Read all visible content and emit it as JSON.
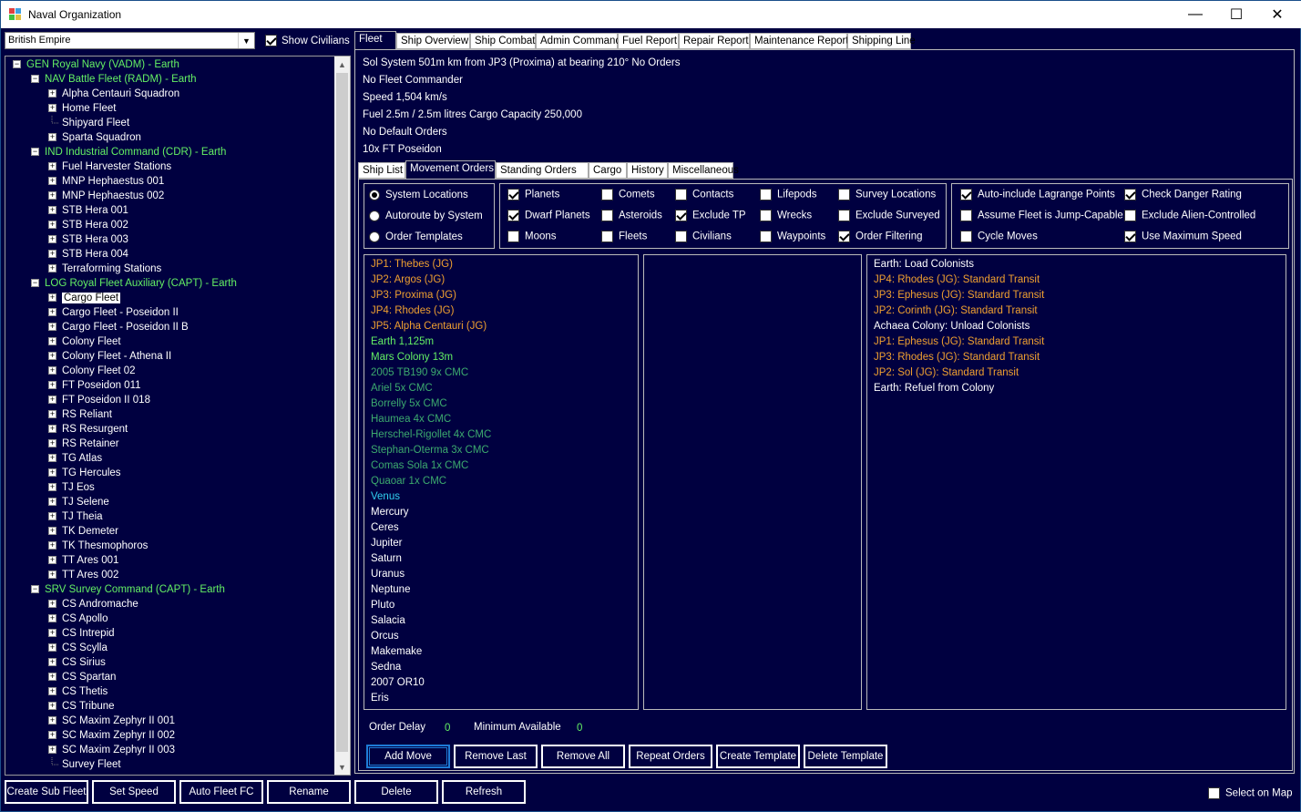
{
  "window": {
    "title": "Naval Organization",
    "minimize": "—",
    "maximize": "☐",
    "close": "✕"
  },
  "empire_select": {
    "value": "British Empire"
  },
  "show_civilians": {
    "label": "Show Civilians",
    "checked": true
  },
  "tree": [
    {
      "label": "GEN Royal Navy  (VADM)  -  Earth",
      "color": "g",
      "level": 0,
      "toggle": "-"
    },
    {
      "label": "NAV Battle Fleet  (RADM)  -  Earth",
      "color": "g",
      "level": 1,
      "toggle": "-"
    },
    {
      "label": "Alpha Centauri Squadron",
      "color": "w",
      "level": 2,
      "toggle": "+"
    },
    {
      "label": "Home Fleet",
      "color": "w",
      "level": 2,
      "toggle": "+"
    },
    {
      "label": "Shipyard Fleet",
      "color": "w",
      "level": 2,
      "toggle": ""
    },
    {
      "label": "Sparta Squadron",
      "color": "w",
      "level": 2,
      "toggle": "+"
    },
    {
      "label": "IND Industrial Command  (CDR)  -  Earth",
      "color": "g",
      "level": 1,
      "toggle": "-"
    },
    {
      "label": "Fuel Harvester Stations",
      "color": "w",
      "level": 2,
      "toggle": "+"
    },
    {
      "label": "MNP Hephaestus 001",
      "color": "w",
      "level": 2,
      "toggle": "+"
    },
    {
      "label": "MNP Hephaestus 002",
      "color": "w",
      "level": 2,
      "toggle": "+"
    },
    {
      "label": "STB Hera 001",
      "color": "w",
      "level": 2,
      "toggle": "+"
    },
    {
      "label": "STB Hera 002",
      "color": "w",
      "level": 2,
      "toggle": "+"
    },
    {
      "label": "STB Hera 003",
      "color": "w",
      "level": 2,
      "toggle": "+"
    },
    {
      "label": "STB Hera 004",
      "color": "w",
      "level": 2,
      "toggle": "+"
    },
    {
      "label": "Terraforming Stations",
      "color": "w",
      "level": 2,
      "toggle": "+"
    },
    {
      "label": "LOG Royal Fleet Auxiliary  (CAPT)  -  Earth",
      "color": "g",
      "level": 1,
      "toggle": "-"
    },
    {
      "label": "Cargo Fleet",
      "color": "sel",
      "level": 2,
      "toggle": "+"
    },
    {
      "label": "Cargo Fleet - Poseidon II",
      "color": "w",
      "level": 2,
      "toggle": "+"
    },
    {
      "label": "Cargo Fleet - Poseidon II B",
      "color": "w",
      "level": 2,
      "toggle": "+"
    },
    {
      "label": "Colony Fleet",
      "color": "w",
      "level": 2,
      "toggle": "+"
    },
    {
      "label": "Colony Fleet - Athena II",
      "color": "w",
      "level": 2,
      "toggle": "+"
    },
    {
      "label": "Colony Fleet 02",
      "color": "w",
      "level": 2,
      "toggle": "+"
    },
    {
      "label": "FT Poseidon 011",
      "color": "w",
      "level": 2,
      "toggle": "+"
    },
    {
      "label": "FT Poseidon II 018",
      "color": "w",
      "level": 2,
      "toggle": "+"
    },
    {
      "label": "RS Reliant",
      "color": "w",
      "level": 2,
      "toggle": "+"
    },
    {
      "label": "RS Resurgent",
      "color": "w",
      "level": 2,
      "toggle": "+"
    },
    {
      "label": "RS Retainer",
      "color": "w",
      "level": 2,
      "toggle": "+"
    },
    {
      "label": "TG Atlas",
      "color": "w",
      "level": 2,
      "toggle": "+"
    },
    {
      "label": "TG Hercules",
      "color": "w",
      "level": 2,
      "toggle": "+"
    },
    {
      "label": "TJ Eos",
      "color": "w",
      "level": 2,
      "toggle": "+"
    },
    {
      "label": "TJ Selene",
      "color": "w",
      "level": 2,
      "toggle": "+"
    },
    {
      "label": "TJ Theia",
      "color": "w",
      "level": 2,
      "toggle": "+"
    },
    {
      "label": "TK Demeter",
      "color": "w",
      "level": 2,
      "toggle": "+"
    },
    {
      "label": "TK Thesmophoros",
      "color": "w",
      "level": 2,
      "toggle": "+"
    },
    {
      "label": "TT Ares 001",
      "color": "w",
      "level": 2,
      "toggle": "+"
    },
    {
      "label": "TT Ares 002",
      "color": "w",
      "level": 2,
      "toggle": "+"
    },
    {
      "label": "SRV Survey Command  (CAPT)  -  Earth",
      "color": "g",
      "level": 1,
      "toggle": "-"
    },
    {
      "label": "CS Andromache",
      "color": "w",
      "level": 2,
      "toggle": "+"
    },
    {
      "label": "CS Apollo",
      "color": "w",
      "level": 2,
      "toggle": "+"
    },
    {
      "label": "CS Intrepid",
      "color": "w",
      "level": 2,
      "toggle": "+"
    },
    {
      "label": "CS Scylla",
      "color": "w",
      "level": 2,
      "toggle": "+"
    },
    {
      "label": "CS Sirius",
      "color": "w",
      "level": 2,
      "toggle": "+"
    },
    {
      "label": "CS Spartan",
      "color": "w",
      "level": 2,
      "toggle": "+"
    },
    {
      "label": "CS Thetis",
      "color": "w",
      "level": 2,
      "toggle": "+"
    },
    {
      "label": "CS Tribune",
      "color": "w",
      "level": 2,
      "toggle": "+"
    },
    {
      "label": "SC Maxim Zephyr II 001",
      "color": "w",
      "level": 2,
      "toggle": "+"
    },
    {
      "label": "SC Maxim Zephyr II 002",
      "color": "w",
      "level": 2,
      "toggle": "+"
    },
    {
      "label": "SC Maxim Zephyr II 003",
      "color": "w",
      "level": 2,
      "toggle": "+"
    },
    {
      "label": "Survey Fleet",
      "color": "w",
      "level": 2,
      "toggle": ""
    }
  ],
  "top_tabs": [
    "Fleet",
    "Ship Overview",
    "Ship Combat",
    "Admin Command",
    "Fuel Report",
    "Repair Report",
    "Maintenance Report",
    "Shipping Line"
  ],
  "fleet_info": {
    "location": "Sol System      501m km from JP3 (Proxima) at bearing 210°       No Orders",
    "commander": "No Fleet Commander",
    "speed": "Speed 1,504 km/s",
    "fuel": "Fuel 2.5m / 2.5m litres    Cargo Capacity 250,000",
    "default_orders": "No Default Orders",
    "ships": "10x FT Poseidon"
  },
  "sub_tabs": [
    "Ship List",
    "Movement Orders",
    "Standing Orders",
    "Cargo",
    "History",
    "Miscellaneous"
  ],
  "location_modes": [
    {
      "label": "System Locations",
      "checked": true
    },
    {
      "label": "Autoroute by System",
      "checked": false
    },
    {
      "label": "Order Templates",
      "checked": false
    }
  ],
  "filters": [
    {
      "label": "Planets",
      "checked": true
    },
    {
      "label": "Dwarf Planets",
      "checked": true
    },
    {
      "label": "Moons",
      "checked": false
    },
    {
      "label": "Comets",
      "checked": false
    },
    {
      "label": "Asteroids",
      "checked": false
    },
    {
      "label": "Fleets",
      "checked": false
    },
    {
      "label": "Contacts",
      "checked": false
    },
    {
      "label": "Exclude TP",
      "checked": true
    },
    {
      "label": "Civilians",
      "checked": false
    },
    {
      "label": "Lifepods",
      "checked": false
    },
    {
      "label": "Wrecks",
      "checked": false
    },
    {
      "label": "Waypoints",
      "checked": false
    },
    {
      "label": "Survey Locations",
      "checked": false
    },
    {
      "label": "Exclude Surveyed",
      "checked": false
    },
    {
      "label": "Order Filtering",
      "checked": true
    }
  ],
  "options": [
    {
      "label": "Auto-include Lagrange Points",
      "checked": true
    },
    {
      "label": "Assume Fleet is Jump-Capable",
      "checked": false
    },
    {
      "label": "Cycle Moves",
      "checked": false
    },
    {
      "label": "Check Danger Rating",
      "checked": true
    },
    {
      "label": "Exclude Alien-Controlled",
      "checked": false
    },
    {
      "label": "Use Maximum Speed",
      "checked": true
    }
  ],
  "locations": [
    {
      "text": "JP1: Thebes (JG)",
      "color": "or"
    },
    {
      "text": "JP2: Argos (JG)",
      "color": "or"
    },
    {
      "text": "JP3: Proxima (JG)",
      "color": "or"
    },
    {
      "text": "JP4: Rhodes (JG)",
      "color": "or"
    },
    {
      "text": "JP5: Alpha Centauri (JG)",
      "color": "or"
    },
    {
      "text": "Earth   1,125m",
      "color": "lg"
    },
    {
      "text": "Mars Colony   13m",
      "color": "lg"
    },
    {
      "text": "2005 TB190   9x CMC",
      "color": "dg"
    },
    {
      "text": "Ariel   5x CMC",
      "color": "dg"
    },
    {
      "text": "Borrelly   5x CMC",
      "color": "dg"
    },
    {
      "text": "Haumea   4x CMC",
      "color": "dg"
    },
    {
      "text": "Herschel-Rigollet   4x CMC",
      "color": "dg"
    },
    {
      "text": "Stephan-Oterma   3x CMC",
      "color": "dg"
    },
    {
      "text": "Comas Sola   1x CMC",
      "color": "dg"
    },
    {
      "text": "Quaoar   1x CMC",
      "color": "dg"
    },
    {
      "text": "Venus",
      "color": "cy"
    },
    {
      "text": "Mercury",
      "color": "w"
    },
    {
      "text": "Ceres",
      "color": "w"
    },
    {
      "text": "Jupiter",
      "color": "w"
    },
    {
      "text": "Saturn",
      "color": "w"
    },
    {
      "text": "Uranus",
      "color": "w"
    },
    {
      "text": "Neptune",
      "color": "w"
    },
    {
      "text": "Pluto",
      "color": "w"
    },
    {
      "text": "Salacia",
      "color": "w"
    },
    {
      "text": "Orcus",
      "color": "w"
    },
    {
      "text": "Makemake",
      "color": "w"
    },
    {
      "text": "Sedna",
      "color": "w"
    },
    {
      "text": "2007 OR10",
      "color": "w"
    },
    {
      "text": "Eris",
      "color": "w"
    }
  ],
  "orders": [
    {
      "text": "Earth: Load Colonists",
      "color": "w"
    },
    {
      "text": "JP4: Rhodes (JG): Standard Transit",
      "color": "or"
    },
    {
      "text": "JP3: Ephesus (JG): Standard Transit",
      "color": "or"
    },
    {
      "text": "JP2: Corinth (JG): Standard Transit",
      "color": "or"
    },
    {
      "text": "Achaea Colony: Unload Colonists",
      "color": "w"
    },
    {
      "text": "JP1: Ephesus (JG): Standard Transit",
      "color": "or"
    },
    {
      "text": "JP3: Rhodes (JG): Standard Transit",
      "color": "or"
    },
    {
      "text": "JP2: Sol (JG): Standard Transit",
      "color": "or"
    },
    {
      "text": "Earth: Refuel from Colony",
      "color": "w"
    }
  ],
  "order_delay": {
    "label": "Order Delay",
    "value": "0"
  },
  "min_available": {
    "label": "Minimum Available",
    "value": "0"
  },
  "order_buttons": [
    "Add Move",
    "Remove Last",
    "Remove All",
    "Repeat Orders",
    "Create Template",
    "Delete Template"
  ],
  "bottom_buttons": [
    "Create Sub Fleet",
    "Set Speed",
    "Auto Fleet FC",
    "Rename",
    "Delete",
    "Refresh"
  ],
  "select_on_map": {
    "label": "Select on Map",
    "checked": false
  }
}
